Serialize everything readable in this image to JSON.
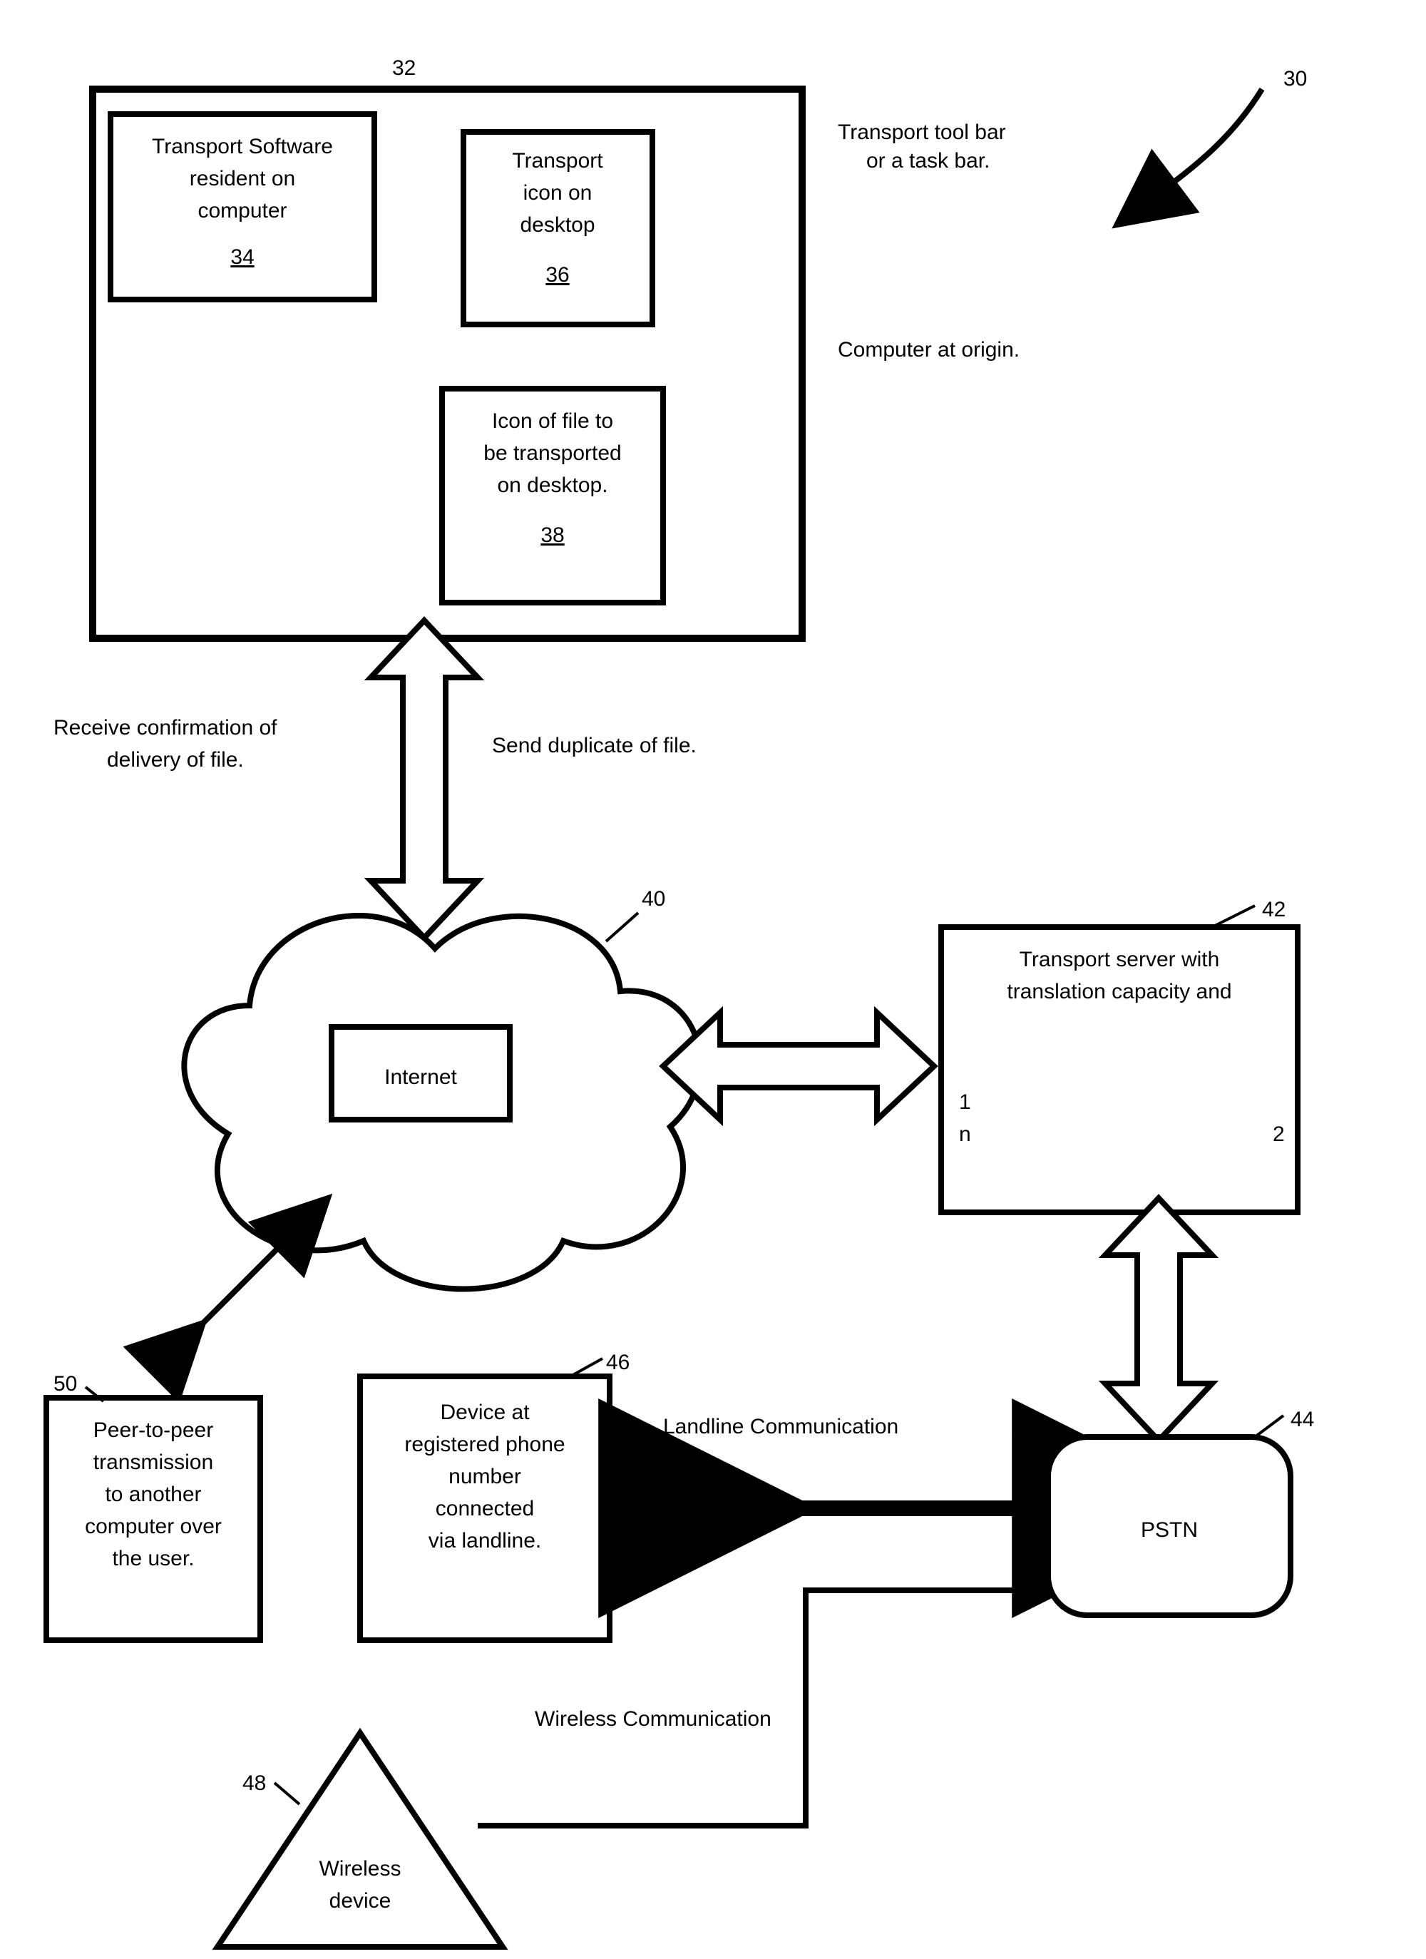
{
  "refs": {
    "system": "30",
    "desktop": "32",
    "software": "34",
    "transportIcon": "36",
    "fileIcon": "38",
    "internet": "40",
    "server": "42",
    "pstn": "44",
    "landlineDevice": "46",
    "wirelessDevice": "48",
    "peer": "50"
  },
  "labels": {
    "toolbar1": "Transport tool bar",
    "toolbar2": "or a task bar.",
    "origin": "Computer at origin.",
    "software1": "Transport Software",
    "software2": "resident on",
    "software3": "computer",
    "ticon1": "Transport",
    "ticon2": "icon on",
    "ticon3": "desktop",
    "file1": "Icon of file to",
    "file2": "be transported",
    "file3": "on desktop.",
    "confirm1": "Receive confirmation of",
    "confirm2": "delivery of file.",
    "send": "Send duplicate of file.",
    "internet": "Internet",
    "server1": "Transport server with",
    "server2": "translation capacity and",
    "serverN1": "1",
    "serverN2": "n",
    "serverN3": "2",
    "peer1": "Peer-to-peer",
    "peer2": "transmission",
    "peer3": "to another",
    "peer4": "computer over",
    "peer5": "the user.",
    "land1": "Device at",
    "land2": "registered phone",
    "land3": "number",
    "land4": "connected",
    "land5": "via landline.",
    "pstn": "PSTN",
    "landComm": "Landline Communication",
    "wireComm": "Wireless Communication",
    "wire1": "Wireless",
    "wire2": "device"
  }
}
